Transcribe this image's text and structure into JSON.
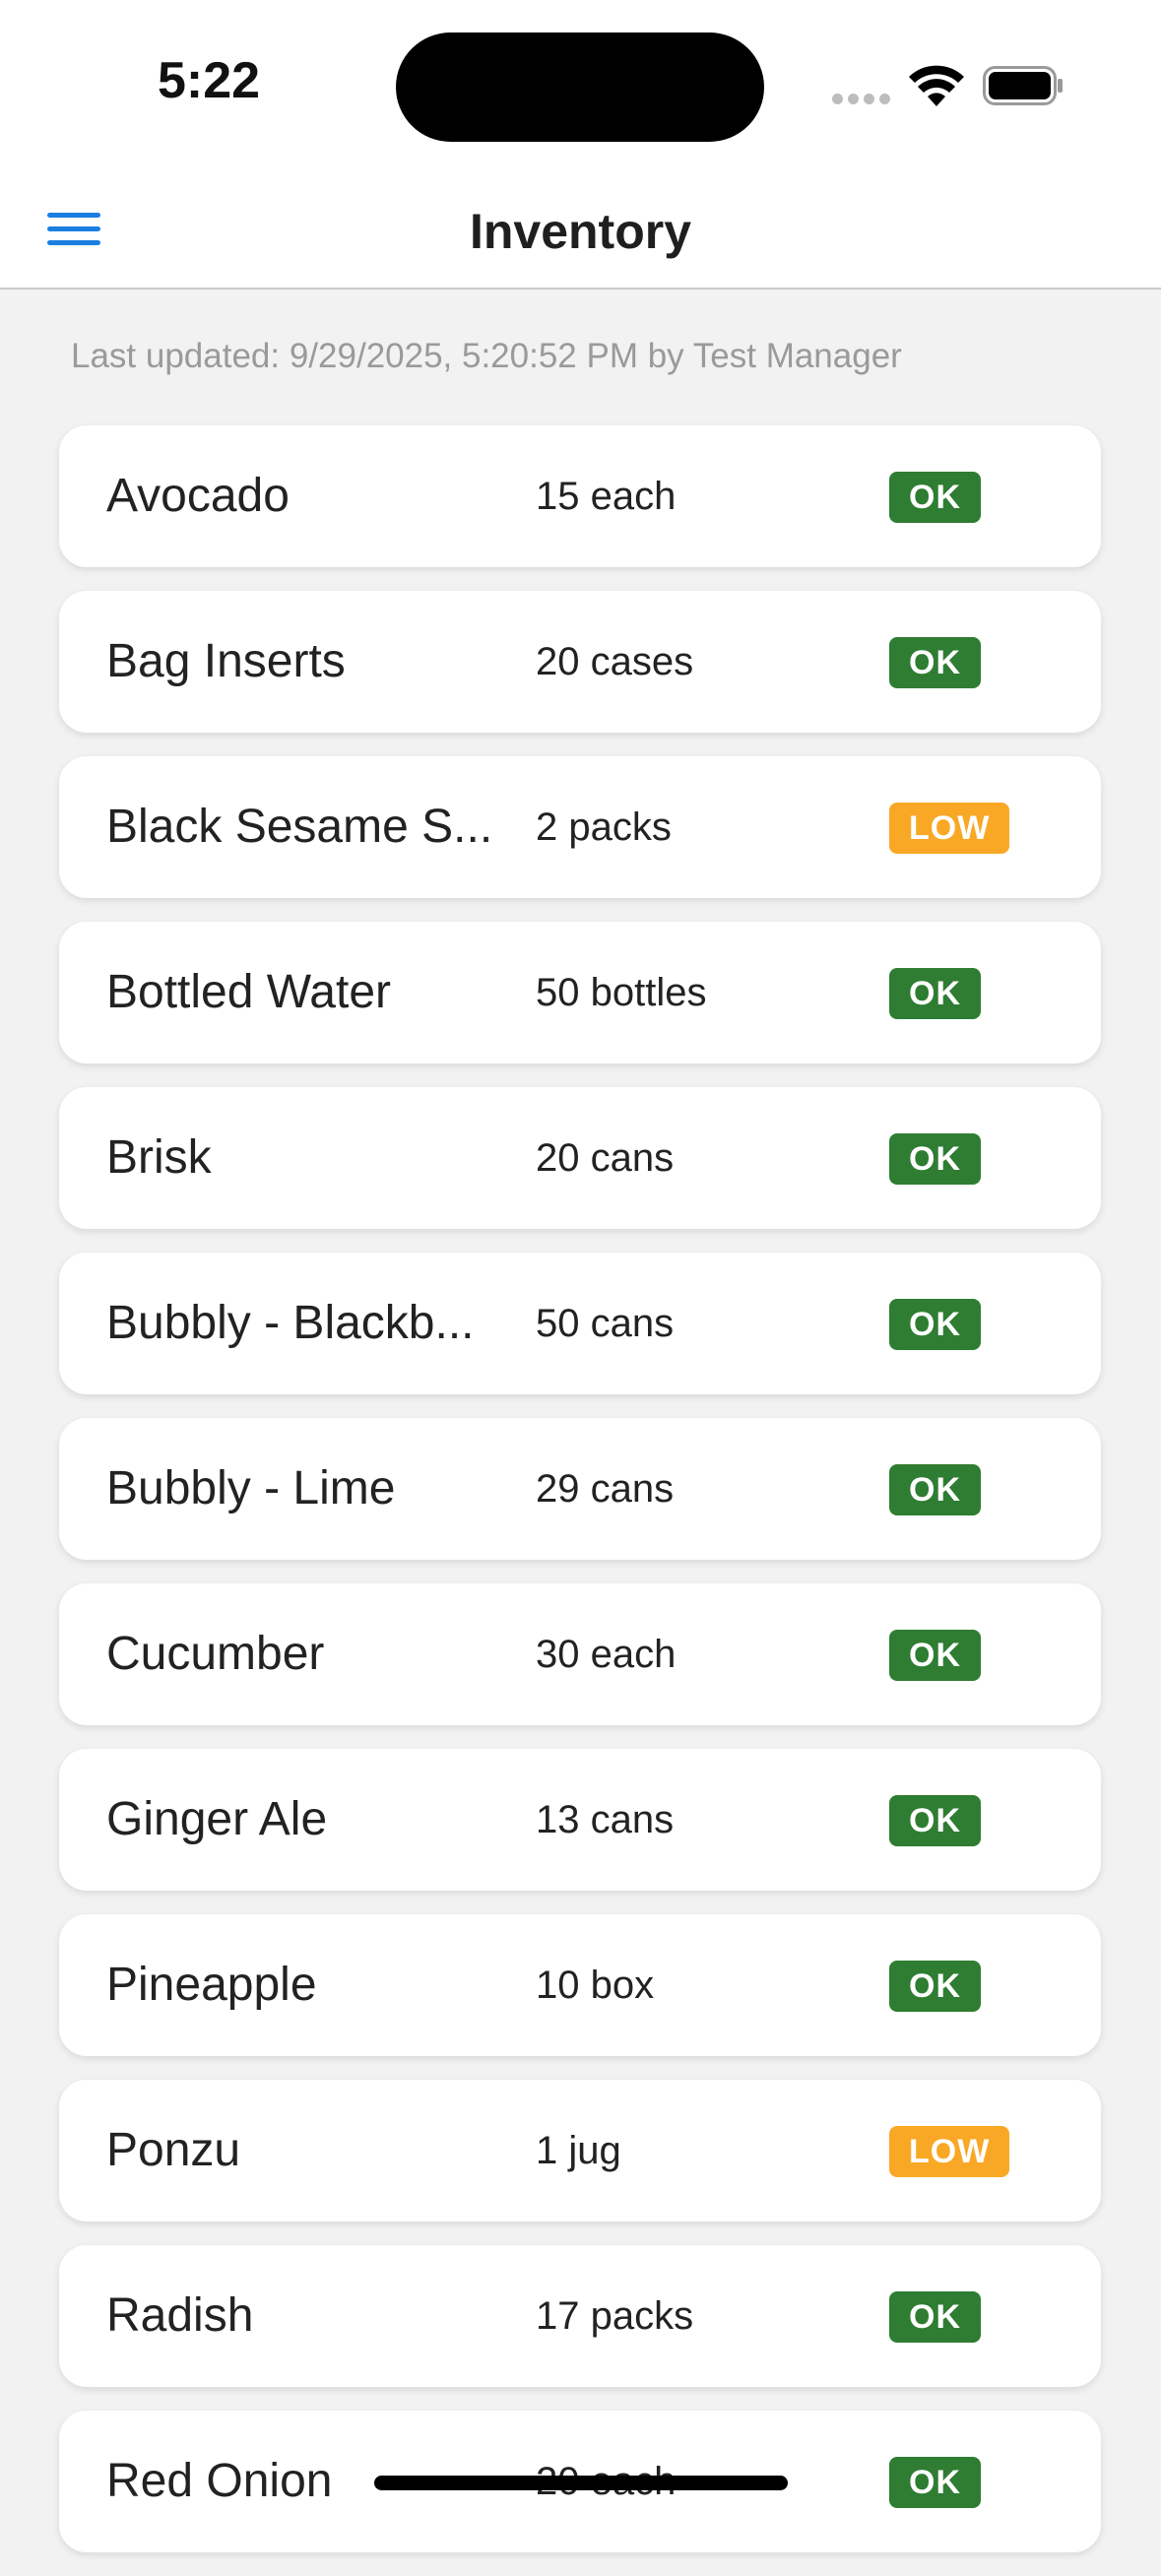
{
  "status_bar": {
    "time": "5:22",
    "icons": [
      "cellular-signal-icon",
      "wifi-icon",
      "battery-icon"
    ]
  },
  "header": {
    "title": "Inventory",
    "menu_icon": "hamburger-menu-icon"
  },
  "last_updated": "Last updated: 9/29/2025, 5:20:52 PM by Test Manager",
  "colors": {
    "accent": "#1a7fe0",
    "ok": "#2e7d32",
    "low": "#f9a825"
  },
  "items": [
    {
      "name": "Avocado",
      "quantity": "15 each",
      "status": "OK"
    },
    {
      "name": "Bag Inserts",
      "quantity": "20 cases",
      "status": "OK"
    },
    {
      "name": "Black Sesame S...",
      "quantity": "2 packs",
      "status": "LOW"
    },
    {
      "name": "Bottled Water",
      "quantity": "50 bottles",
      "status": "OK"
    },
    {
      "name": "Brisk",
      "quantity": "20 cans",
      "status": "OK"
    },
    {
      "name": "Bubbly - Blackb...",
      "quantity": "50 cans",
      "status": "OK"
    },
    {
      "name": "Bubbly - Lime",
      "quantity": "29 cans",
      "status": "OK"
    },
    {
      "name": "Cucumber",
      "quantity": "30 each",
      "status": "OK"
    },
    {
      "name": "Ginger Ale",
      "quantity": "13 cans",
      "status": "OK"
    },
    {
      "name": "Pineapple",
      "quantity": "10 box",
      "status": "OK"
    },
    {
      "name": "Ponzu",
      "quantity": "1 jug",
      "status": "LOW"
    },
    {
      "name": "Radish",
      "quantity": "17 packs",
      "status": "OK"
    },
    {
      "name": "Red Onion",
      "quantity": "20 each",
      "status": "OK"
    }
  ]
}
